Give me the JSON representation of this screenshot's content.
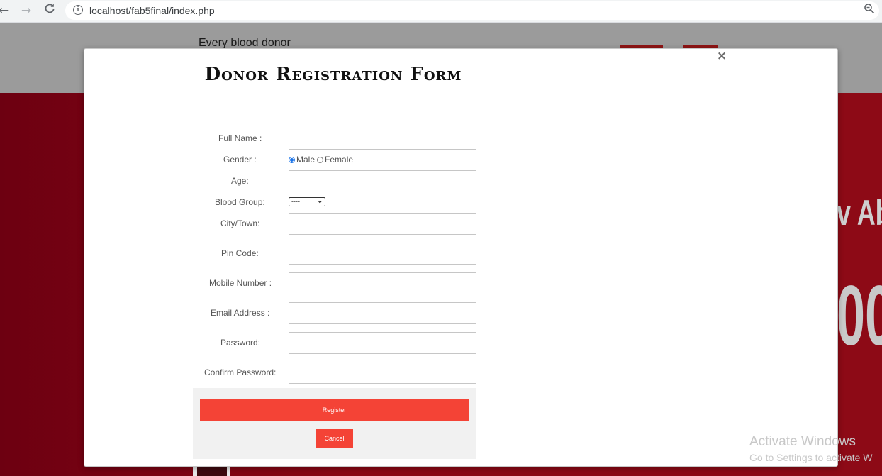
{
  "browser": {
    "url": "localhost/fab5final/index.php"
  },
  "page": {
    "tagline": "Every blood donor",
    "hero_line1": "v Ab",
    "hero_line2": "00"
  },
  "modal": {
    "title": "Donor Registration Form",
    "fields": {
      "full_name": "Full Name :",
      "gender": "Gender :",
      "age": "Age:",
      "blood_group": "Blood Group:",
      "city": "City/Town:",
      "pin_code": "Pin Code:",
      "mobile": "Mobile Number :",
      "email": "Email Address :",
      "password": "Password:",
      "confirm_password": "Confirm Password:"
    },
    "gender_options": {
      "male": "Male",
      "female": "Female",
      "selected": "Male"
    },
    "blood_group_selected": "----",
    "register_label": "Register",
    "cancel_label": "Cancel"
  },
  "watermark": {
    "line1": "Activate Windows",
    "line2": "Go to Settings to activate W"
  },
  "colors": {
    "accent": "#f44336",
    "hero": "#8a0714",
    "header": "#9b9b9b"
  }
}
